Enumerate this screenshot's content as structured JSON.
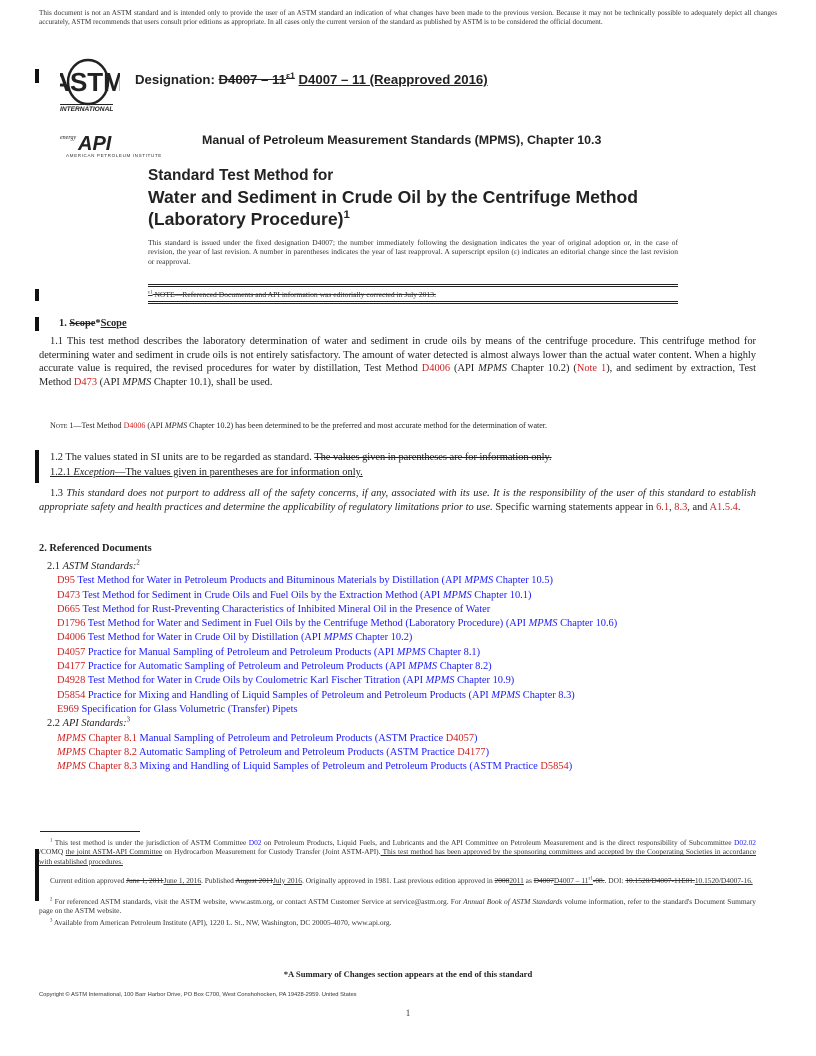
{
  "disclaimer": "This document is not an ASTM standard and is intended only to provide the user of an ASTM standard an indication of what changes have been made to the previous version. Because it may not be technically possible to adequately depict all changes accurately, ASTM recommends that users consult prior editions as appropriate. In all cases only the current version of the standard as published by ASTM is to be considered the official document.",
  "header": {
    "astm_logo_icon": "astm-international-logo",
    "astm_logo_caption": "INTERNATIONAL",
    "designation_label": "Designation: ",
    "designation_old": "D4007 – 11",
    "designation_old_sup": "ε1",
    "designation_new": "D4007 – 11 (Reapproved 2016)",
    "api_logo_icon": "api-energy-logo",
    "api_logo_small": "energy",
    "api_logo_text": "API",
    "api_caption": "AMERICAN PETROLEUM INSTITUTE",
    "mpms_line": "Manual of Petroleum Measurement Standards (MPMS), Chapter 10.3"
  },
  "title": {
    "line1": "Standard Test Method for",
    "line2": "Water and Sediment in Crude Oil by the Centrifuge Method (Laboratory Procedure)",
    "footnote_mark": "1"
  },
  "issued_text": "This standard is issued under the fixed designation D4007; the number immediately following the designation indicates the year of original adoption or, in the case of revision, the year of last revision. A number in parentheses indicates the year of last reapproval. A superscript epsilon (ε) indicates an editorial change since the last revision or reapproval.",
  "epsilon_note": {
    "sup": "ε1",
    "text": " NOTE—Referenced Documents and API information was editorially corrected in July 2013."
  },
  "section1": {
    "heading_num": "1. ",
    "heading_old": "Scope",
    "heading_star": "*",
    "heading_new": "Scope",
    "p11_a": "1.1 This test method describes the laboratory determination of water and sediment in crude oils by means of the centrifuge procedure. This centrifuge method for determining water and sediment in crude oils is not entirely satisfactory. The amount of water detected is almost always lower than the actual water content. When a highly accurate value is required, the revised procedures for water by distillation, Test Method ",
    "p11_link1": "D4006",
    "p11_b": " (API ",
    "p11_mpms1": "MPMS",
    "p11_c": " Chapter 10.2) (",
    "p11_note": "Note 1",
    "p11_d": "), and sediment by extraction, Test Method ",
    "p11_link2": "D473",
    "p11_e": " (API ",
    "p11_mpms2": "MPMS",
    "p11_f": " Chapter 10.1), shall be used.",
    "note1_label": "Note 1",
    "note1_a": "—Test Method ",
    "note1_link": "D4006",
    "note1_b": " (API ",
    "note1_mpms": "MPMS",
    "note1_c": " Chapter 10.2) has been determined to be the preferred and most accurate method for the determination of water.",
    "p12_a": "1.2 The values stated in SI units are to be regarded as standard. ",
    "p12_struck": "The values given in parentheses are for information only.",
    "p121_num": "1.2.1 ",
    "p121_em": "Exception",
    "p121_text": "—The values given in parentheses are for information only.",
    "p13_num": "1.3 ",
    "p13_em": "This standard does not purport to address all of the safety concerns, if any, associated with its use. It is the responsibility of the user of this standard to establish appropriate safety and health practices and determine the applicability of regulatory limitations prior to use.",
    "p13_a": " Specific warning statements appear in ",
    "p13_l1": "6.1",
    "p13_b": ", ",
    "p13_l2": "8.3",
    "p13_c": ", and ",
    "p13_l3": "A1.5.4",
    "p13_d": "."
  },
  "section2": {
    "heading": "2. Referenced Documents",
    "astm_label_num": "2.1 ",
    "astm_label": "ASTM Standards:",
    "astm_sup": "2",
    "astm_refs": [
      {
        "code": "D95",
        "title": "Test Method for Water in Petroleum Products and Bituminous Materials by Distillation (API ",
        "mpms": "MPMS",
        "tail": " Chapter 10.5)"
      },
      {
        "code": "D473",
        "title": "Test Method for Sediment in Crude Oils and Fuel Oils by the Extraction Method (API ",
        "mpms": "MPMS",
        "tail": " Chapter 10.1)"
      },
      {
        "code": "D665",
        "title": "Test Method for Rust-Preventing Characteristics of Inhibited Mineral Oil in the Presence of Water",
        "mpms": "",
        "tail": ""
      },
      {
        "code": "D1796",
        "title": "Test Method for Water and Sediment in Fuel Oils by the Centrifuge Method (Laboratory Procedure) (API ",
        "mpms": "MPMS",
        "tail": " Chapter 10.6)"
      },
      {
        "code": "D4006",
        "title": "Test Method for Water in Crude Oil by Distillation (API ",
        "mpms": "MPMS",
        "tail": " Chapter 10.2)"
      },
      {
        "code": "D4057",
        "title": "Practice for Manual Sampling of Petroleum and Petroleum Products (API ",
        "mpms": "MPMS",
        "tail": " Chapter 8.1)"
      },
      {
        "code": "D4177",
        "title": "Practice for Automatic Sampling of Petroleum and Petroleum Products (API ",
        "mpms": "MPMS",
        "tail": " Chapter 8.2)"
      },
      {
        "code": "D4928",
        "title": "Test Method for Water in Crude Oils by Coulometric Karl Fischer Titration (API ",
        "mpms": "MPMS",
        "tail": " Chapter 10.9)"
      },
      {
        "code": "D5854",
        "title": "Practice for Mixing and Handling of Liquid Samples of Petroleum and Petroleum Products (API ",
        "mpms": "MPMS",
        "tail": " Chapter 8.3)"
      },
      {
        "code": "E969",
        "title": "Specification for Glass Volumetric (Transfer) Pipets",
        "mpms": "",
        "tail": ""
      }
    ],
    "api_label_num": "2.2 ",
    "api_label": "API Standards:",
    "api_sup": "3",
    "api_refs": [
      {
        "mpms": "MPMS",
        "chapter": " Chapter 8.1",
        "title": " Manual Sampling of Petroleum and Petroleum Products (ASTM Practice ",
        "code": "D4057",
        "tail": ")"
      },
      {
        "mpms": "MPMS",
        "chapter": " Chapter 8.2",
        "title": " Automatic Sampling of Petroleum and Petroleum Products (ASTM Practice ",
        "code": "D4177",
        "tail": ")"
      },
      {
        "mpms": "MPMS",
        "chapter": " Chapter 8.3",
        "title": " Mixing and Handling of Liquid Samples of Petroleum and Petroleum Products (ASTM Practice ",
        "code": "D5854",
        "tail": ")"
      }
    ]
  },
  "footnotes": {
    "fn1_sup": "1",
    "fn1_a": " This test method is under the jurisdiction of ASTM Committee ",
    "fn1_l1": "D02",
    "fn1_b": " on Petroleum Products, Liquid Fuels, and Lubricants and the API Committee on Petroleum Measurement and is the direct responsibility of Subcommittee ",
    "fn1_l2": "D02.02",
    "fn1_c": " /COMQ ",
    "fn1_u1": "the joint ASTM-API Committee",
    "fn1_d": " on Hydrocarbon Measurement for Custody Transfer (Joint ASTM-API).",
    "fn1_u2": " This test method has been approved by the sponsoring committees and accepted by the Cooperating Societies in accordance with established procedures.",
    "ed_a": "Current edition approved ",
    "ed_old1": "June 1, 2011",
    "ed_new1": "June 1, 2016",
    "ed_b": ". Published ",
    "ed_old2": "August 2011",
    "ed_new2": "July 2016",
    "ed_c": ". Originally approved in 1981. Last previous edition approved in ",
    "ed_old3": "2008",
    "ed_new3": "2011",
    "ed_d": " as ",
    "ed_old4": "D4007",
    "ed_new4": "D4007 – 11",
    "ed_sup": "ε1",
    "ed_old5": "-08.",
    "ed_e": ". DOI: ",
    "ed_old6": "10.1520/D4007-11E01.",
    "ed_new6": "10.1520/D4007-16.",
    "fn2_sup": "2",
    "fn2_a": " For referenced ASTM standards, visit the ASTM website, www.astm.org, or contact ASTM Customer Service at service@astm.org. For ",
    "fn2_em": "Annual Book of ASTM Standards",
    "fn2_b": " volume information, refer to the standard's Document Summary page on the ASTM website.",
    "fn3_sup": "3",
    "fn3": " Available from American Petroleum Institute (API), 1220 L. St., NW, Washington, DC 20005-4070, www.api.org."
  },
  "summary_note": "*A Summary of Changes section appears at the end of this standard",
  "copyright": "Copyright © ASTM International, 100 Barr Harbor Drive, PO Box C700, West Conshohocken, PA 19428-2959. United States",
  "page_number": "1",
  "colors": {
    "link_red": "#cc2222",
    "ref_blue": "#1a1aff",
    "text": "#222222"
  }
}
